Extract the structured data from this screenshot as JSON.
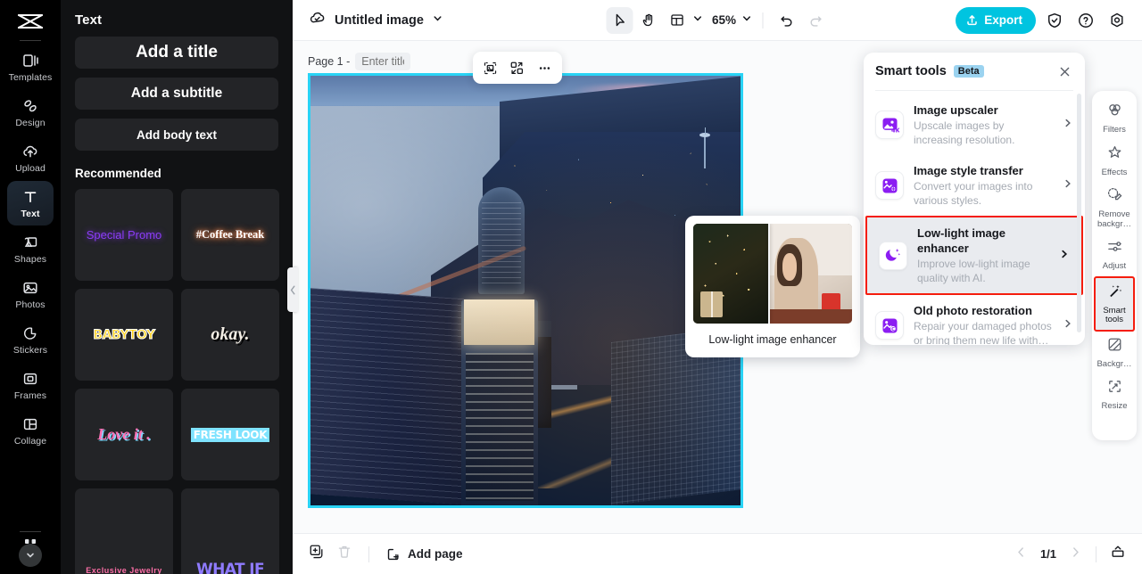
{
  "rail": {
    "logo_icon": "capcut-logo-icon",
    "items": [
      {
        "label": "Templates",
        "icon": "templates-icon",
        "active": false
      },
      {
        "label": "Design",
        "icon": "design-icon",
        "active": false
      },
      {
        "label": "Upload",
        "icon": "upload-cloud-icon",
        "active": false
      },
      {
        "label": "Text",
        "icon": "text-icon",
        "active": true
      },
      {
        "label": "Shapes",
        "icon": "shapes-icon",
        "active": false
      },
      {
        "label": "Photos",
        "icon": "photos-icon",
        "active": false
      },
      {
        "label": "Stickers",
        "icon": "stickers-icon",
        "active": false
      },
      {
        "label": "Frames",
        "icon": "frames-icon",
        "active": false
      },
      {
        "label": "Collage",
        "icon": "collage-icon",
        "active": false
      }
    ],
    "expand_icon": "chevron-down-icon"
  },
  "panel": {
    "title": "Text",
    "buttons": {
      "add_title": "Add a title",
      "add_subtitle": "Add a subtitle",
      "add_body": "Add body text"
    },
    "section_title": "Recommended",
    "cards": [
      {
        "text": "Special Promo",
        "style": "sp1"
      },
      {
        "text": "#Coffee Break",
        "style": "sp2"
      },
      {
        "text": "BABYTOY",
        "style": "sp3"
      },
      {
        "text": "okay.",
        "style": "sp4"
      },
      {
        "text": "Love it .",
        "style": "sp5"
      },
      {
        "text": "FRESH LOOK",
        "style": "sp6"
      },
      {
        "text": "Exclusive Jewelry",
        "style": "sp7"
      },
      {
        "text": "WHAT IF",
        "style": "sp8"
      }
    ],
    "collapse_icon": "chevron-left-icon"
  },
  "topbar": {
    "cloud_icon": "cloud-saved-icon",
    "doc_title": "Untitled image",
    "doc_chevron_icon": "chevron-down-icon",
    "tools": [
      {
        "name": "select-tool",
        "icon": "cursor-arrow-icon",
        "selected": true
      },
      {
        "name": "hand-tool",
        "icon": "hand-icon",
        "selected": false
      },
      {
        "name": "layout-tool",
        "icon": "layout-icon",
        "selected": false
      }
    ],
    "layout_chevron_icon": "chevron-down-icon",
    "zoom_level": "65%",
    "zoom_chevron_icon": "chevron-down-icon",
    "undo_icon": "undo-icon",
    "redo_icon": "redo-icon",
    "export_label": "Export",
    "export_icon": "export-upload-icon",
    "export_color": "#00c4e0",
    "shield_icon": "shield-check-icon",
    "help_icon": "question-circle-icon",
    "settings_icon": "gear-icon"
  },
  "canvas": {
    "page_label": "Page 1 -",
    "title_placeholder": "Enter title",
    "title_value": "",
    "duplicate_icon": "duplicate-page-icon",
    "more_icon": "more-horizontal-icon",
    "float_toolbar": [
      {
        "name": "crop-tool",
        "icon": "crop-selection-icon"
      },
      {
        "name": "replace-tool",
        "icon": "replace-swap-icon"
      },
      {
        "name": "more-tool",
        "icon": "more-horizontal-icon"
      }
    ],
    "selection_color": "#29d3f5",
    "artboard_alt": "Aerial night photo of a city skyline by the water"
  },
  "preview": {
    "caption": "Low-light image enhancer",
    "alt": "Before and after comparison of a woman drinking at a holiday table"
  },
  "smart_tools": {
    "title": "Smart tools",
    "badge": "Beta",
    "badge_color": "#9bd3f0",
    "close_icon": "close-icon",
    "highlight_color": "#f51d0e",
    "items": [
      {
        "name": "Image upscaler",
        "desc": "Upscale images by increasing resolution.",
        "icon": "image-upscaler-4k-icon",
        "highlighted": false
      },
      {
        "name": "Image style transfer",
        "desc": "Convert your images into various styles.",
        "icon": "image-style-transfer-icon",
        "highlighted": false
      },
      {
        "name": "Low-light image enhancer",
        "desc": "Improve low-light image quality with AI.",
        "icon": "moon-stars-icon",
        "highlighted": true
      },
      {
        "name": "Old photo restoration",
        "desc": "Repair your damaged photos or bring them new life with…",
        "icon": "old-photo-restoration-icon",
        "highlighted": false
      }
    ]
  },
  "right_rail": {
    "items": [
      {
        "label": "Filters",
        "icon": "filters-icon",
        "highlighted": false
      },
      {
        "label": "Effects",
        "icon": "effects-sparkle-icon",
        "highlighted": false
      },
      {
        "label": "Remove backgr…",
        "icon": "remove-background-icon",
        "highlighted": false
      },
      {
        "label": "Adjust",
        "icon": "adjust-sliders-icon",
        "highlighted": false
      },
      {
        "label": "Smart tools",
        "icon": "smart-tools-wand-icon",
        "highlighted": true
      },
      {
        "label": "Backgr…",
        "icon": "background-icon",
        "highlighted": false
      },
      {
        "label": "Resize",
        "icon": "resize-icon",
        "highlighted": false
      }
    ]
  },
  "bottom": {
    "duplicate_icon": "duplicate-icon",
    "delete_icon": "trash-icon",
    "add_page_label": "Add page",
    "add_page_icon": "add-page-icon",
    "prev_icon": "chevron-left-icon",
    "page_indicator": "1/1",
    "next_icon": "chevron-right-icon",
    "expand_icon": "expand-panel-icon"
  }
}
